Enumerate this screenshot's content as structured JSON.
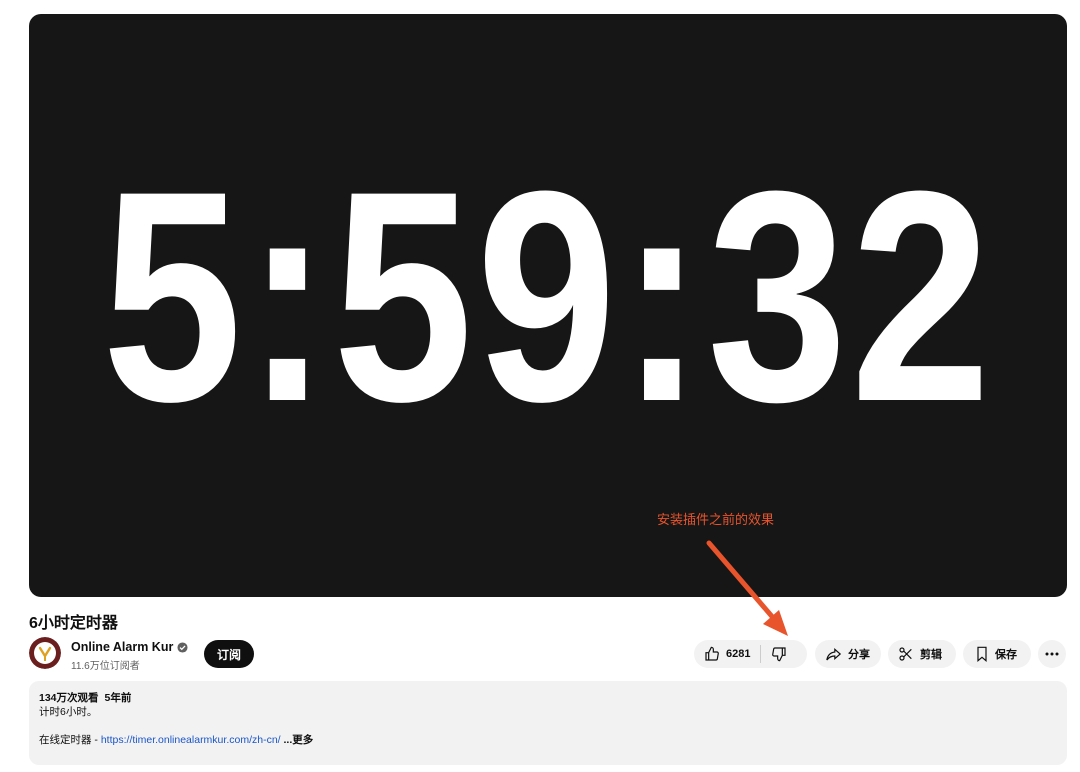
{
  "player": {
    "timer": "5:59:32",
    "annotation": "安装插件之前的效果",
    "annotation_color": "#e8542c"
  },
  "video": {
    "title": "6小时定时器"
  },
  "channel": {
    "name": "Online Alarm Kur",
    "subscribers": "11.6万位订阅者",
    "subscribe_label": "订阅"
  },
  "actions": {
    "like_count": "6281",
    "share_label": "分享",
    "clip_label": "剪辑",
    "save_label": "保存",
    "more_icon": "more-horizontal-icon"
  },
  "description": {
    "views": "134万次观看",
    "age": "5年前",
    "line1": "计时6小时。",
    "link_prefix": "在线定时器 - ",
    "link_url": "https://timer.onlinealarmkur.com/zh-cn/",
    "more_label": "...更多"
  }
}
